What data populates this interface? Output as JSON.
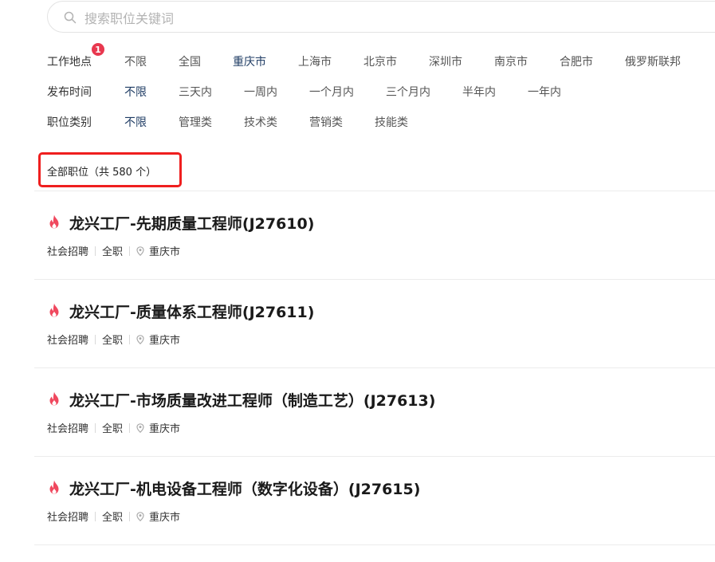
{
  "search": {
    "placeholder": "搜索职位关键词"
  },
  "filters": [
    {
      "label": "工作地点",
      "badge": "1",
      "options": [
        "不限",
        "全国",
        "重庆市",
        "上海市",
        "北京市",
        "深圳市",
        "南京市",
        "合肥市",
        "俄罗斯联邦"
      ],
      "selected": "重庆市"
    },
    {
      "label": "发布时间",
      "options": [
        "不限",
        "三天内",
        "一周内",
        "一个月内",
        "三个月内",
        "半年内",
        "一年内"
      ],
      "selected": "不限"
    },
    {
      "label": "职位类别",
      "options": [
        "不限",
        "管理类",
        "技术类",
        "营销类",
        "技能类"
      ],
      "selected": "不限"
    }
  ],
  "summary": {
    "text": "全部职位（共 580 个）"
  },
  "jobs": [
    {
      "title": "龙兴工厂-先期质量工程师(J27610)",
      "recruit_type": "社会招聘",
      "employment": "全职",
      "location": "重庆市"
    },
    {
      "title": "龙兴工厂-质量体系工程师(J27611)",
      "recruit_type": "社会招聘",
      "employment": "全职",
      "location": "重庆市"
    },
    {
      "title": "龙兴工厂-市场质量改进工程师（制造工艺）(J27613)",
      "recruit_type": "社会招聘",
      "employment": "全职",
      "location": "重庆市"
    },
    {
      "title": "龙兴工厂-机电设备工程师（数字化设备）(J27615)",
      "recruit_type": "社会招聘",
      "employment": "全职",
      "location": "重庆市"
    }
  ],
  "colors": {
    "accent": "#1f3c64",
    "badge": "#e8384f",
    "fire": "#f0485e",
    "highlight_border": "#ef1f1f"
  },
  "icons": {
    "search": "search-icon",
    "fire": "fire-icon",
    "location": "location-pin-icon"
  }
}
